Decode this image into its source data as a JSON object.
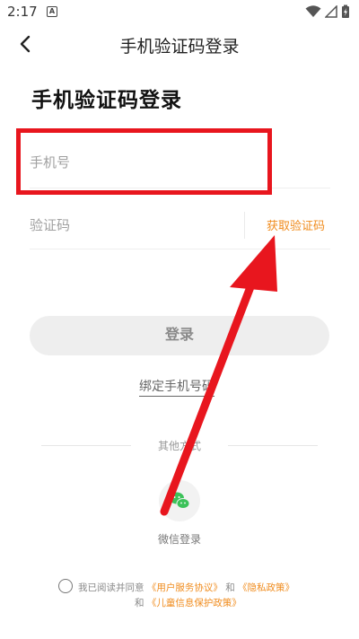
{
  "status_bar": {
    "time": "2:17",
    "notification_icon": "A"
  },
  "nav": {
    "title": "手机验证码登录",
    "back_icon": "chevron-left-icon"
  },
  "heading": "手机验证码登录",
  "phone": {
    "placeholder": "手机号"
  },
  "code": {
    "placeholder": "验证码",
    "get_code_label": "获取验证码"
  },
  "login_button": "登录",
  "bind_link": "绑定手机号码",
  "other_methods": "其他方式",
  "wechat_label": "微信登录",
  "agreement": {
    "prefix": "我已阅读并同意",
    "user_agreement": "《用户服务协议》",
    "and1": "和",
    "privacy": "《隐私政策》",
    "and2": "和",
    "child_policy": "《儿童信息保护政策》"
  },
  "colors": {
    "accent": "#f08c1e",
    "annotation": "#e8161e",
    "wechat": "#3cc25a"
  }
}
